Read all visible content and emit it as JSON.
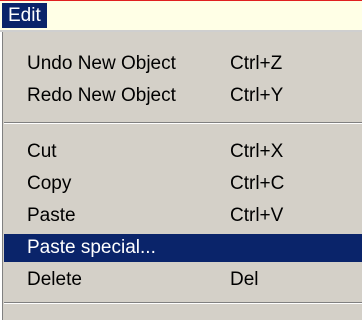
{
  "menubar": {
    "title": "Edit"
  },
  "menu": {
    "undo": {
      "label": "Undo New Object",
      "shortcut": "Ctrl+Z"
    },
    "redo": {
      "label": "Redo New Object",
      "shortcut": "Ctrl+Y"
    },
    "cut": {
      "label": "Cut",
      "shortcut": "Ctrl+X"
    },
    "copy": {
      "label": "Copy",
      "shortcut": "Ctrl+C"
    },
    "paste": {
      "label": "Paste",
      "shortcut": "Ctrl+V"
    },
    "paste_special": {
      "label": "Paste special...",
      "shortcut": ""
    },
    "delete": {
      "label": "Delete",
      "shortcut": "Del"
    }
  },
  "colors": {
    "highlight": "#0a246a",
    "menu_background": "#d4d0c8",
    "menubar_background": "#ffffe6",
    "top_line": "#e02020"
  }
}
